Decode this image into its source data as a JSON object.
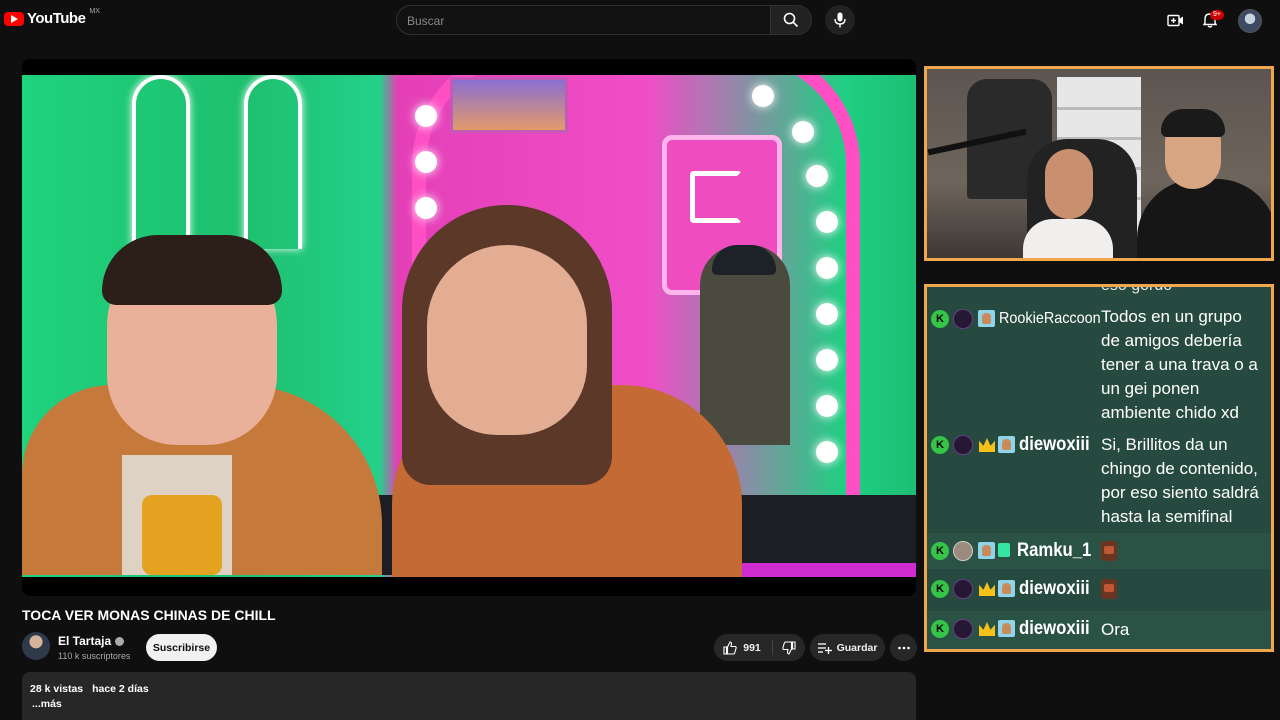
{
  "header": {
    "logo_text": "YouTube",
    "country": "MX",
    "search_placeholder": "Buscar",
    "notification_count": "9+"
  },
  "chat": {
    "cut_line": "eso gordo",
    "messages": [
      {
        "user": "RookieRaccoon",
        "text": "Todos en un grupo de amigos debería tener a una trava o a un gei ponen ambiente chido xd"
      },
      {
        "user": "diewoxiii",
        "text": "Si, Brillitos da un chingo de contenido, por eso siento saldrá hasta la semifinal"
      },
      {
        "user": "Ramku_1",
        "text": ""
      },
      {
        "user": "diewoxiii",
        "text": ""
      },
      {
        "user": "diewoxiii",
        "text": "Ora"
      }
    ]
  },
  "video": {
    "title": "TOCA VER MONAS CHINAS DE CHILL",
    "channel": "El Tartaja",
    "subscribers": "110 k suscriptores",
    "subscribe_label": "Suscribirse",
    "likes": "991",
    "save_label": "Guardar",
    "views": "28 k vistas",
    "published": "hace 2 días",
    "more_label": "...más"
  }
}
